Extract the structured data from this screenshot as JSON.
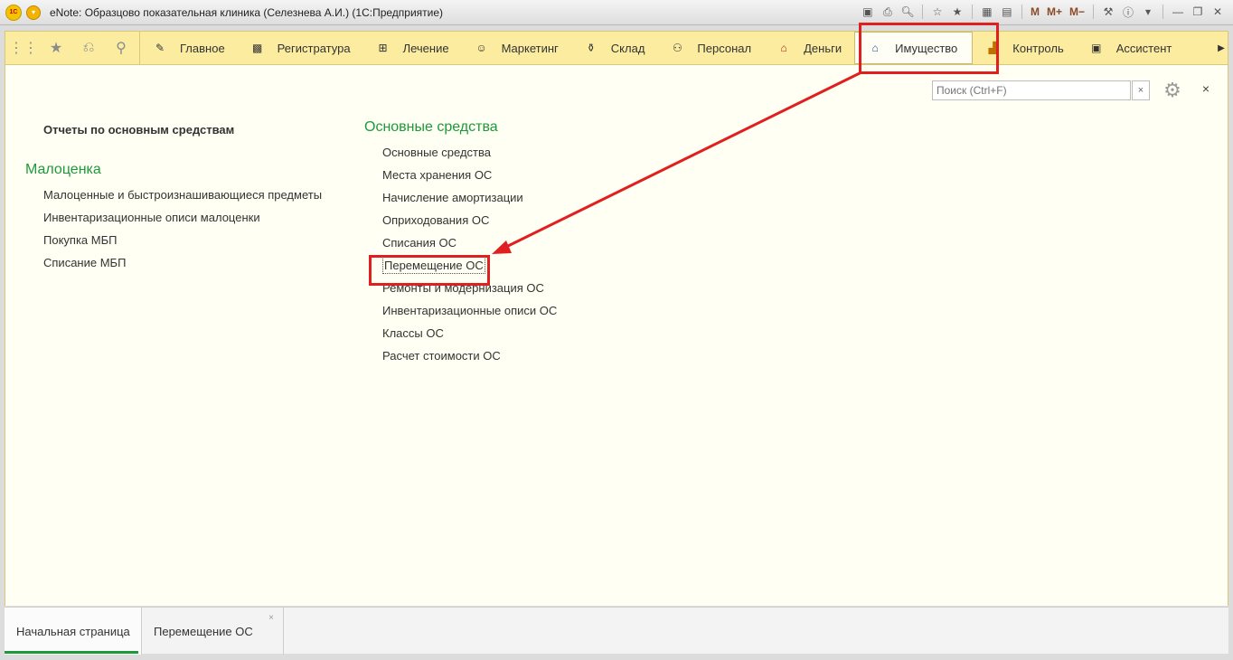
{
  "window": {
    "title": "eNote: Образцово показательная клиника (Селезнева А.И.)  (1С:Предприятие)",
    "logo_text": "1C",
    "toolbar_text_buttons": [
      "M",
      "M+",
      "M−"
    ]
  },
  "sections": [
    {
      "label": "Главное",
      "icon": "pencil-icon"
    },
    {
      "label": "Регистратура",
      "icon": "registry-icon"
    },
    {
      "label": "Лечение",
      "icon": "treatment-icon"
    },
    {
      "label": "Маркетинг",
      "icon": "marketing-icon"
    },
    {
      "label": "Склад",
      "icon": "warehouse-icon"
    },
    {
      "label": "Персонал",
      "icon": "staff-icon"
    },
    {
      "label": "Деньги",
      "icon": "money-icon"
    },
    {
      "label": "Имущество",
      "icon": "property-icon",
      "active": true
    },
    {
      "label": "Контроль",
      "icon": "chart-icon"
    },
    {
      "label": "Ассистент",
      "icon": "assistant-icon"
    }
  ],
  "search": {
    "placeholder": "Поиск (Ctrl+F)",
    "clear": "×"
  },
  "close_label": "×",
  "left_column": {
    "reports_title": "Отчеты по основным средствам",
    "group_title": "Малоценка",
    "items": [
      "Малоценные и быстроизнашивающиеся предметы",
      "Инвентаризационные описи малоценки",
      "Покупка МБП",
      "Списание МБП"
    ]
  },
  "mid_column": {
    "group_title": "Основные средства",
    "items": [
      "Основные средства",
      "Места хранения ОС",
      "Начисление амортизации",
      "Оприходования ОС",
      "Списания ОС",
      "Перемещение ОС",
      "Ремонты и модернизация ОС",
      "Инвентаризационные описи ОС",
      "Классы ОС",
      "Расчет стоимости ОС"
    ]
  },
  "bottom_tabs": [
    {
      "label": "Начальная страница",
      "active": true
    },
    {
      "label": "Перемещение ОС",
      "close": "×"
    }
  ],
  "colors": {
    "accent_green": "#1c9a3b",
    "section_bg": "#fbeca0",
    "annotation_red": "#e02020"
  }
}
